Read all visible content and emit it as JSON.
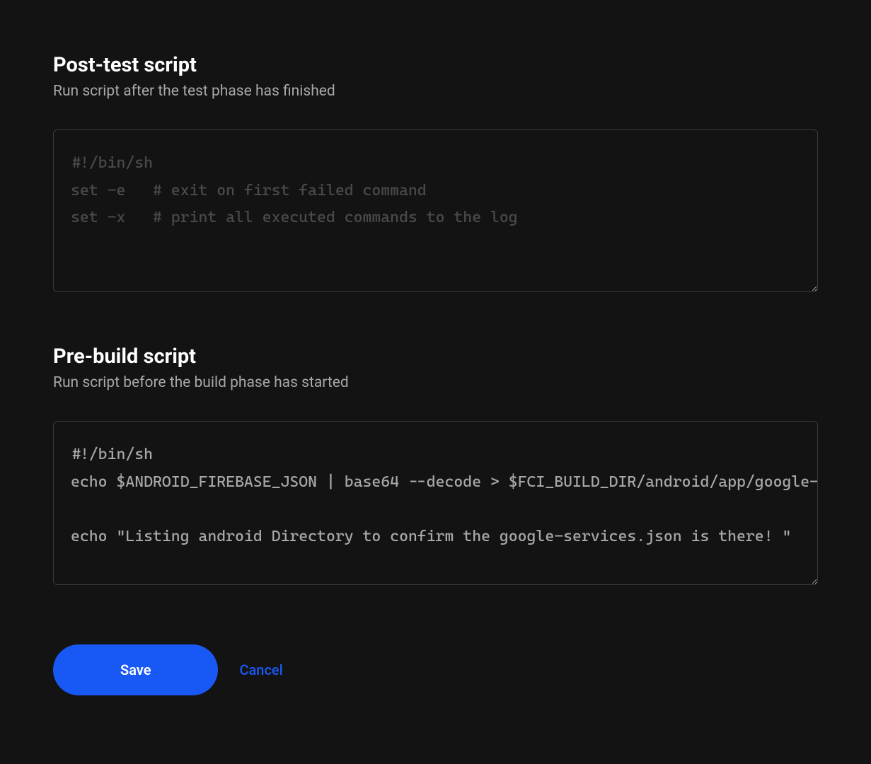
{
  "post_test": {
    "title": "Post-test script",
    "description": "Run script after the test phase has finished",
    "placeholder": "#!/bin/sh\nset -e   # exit on first failed command\nset -x   # print all executed commands to the log",
    "value": ""
  },
  "pre_build": {
    "title": "Pre-build script",
    "description": "Run script before the build phase has started",
    "value": "#!/bin/sh\necho $ANDROID_FIREBASE_JSON | base64 --decode > $FCI_BUILD_DIR/android/app/google-services.json\n\necho \"Listing android Directory to confirm the google-services.json is there! \""
  },
  "buttons": {
    "save_label": "Save",
    "cancel_label": "Cancel"
  }
}
